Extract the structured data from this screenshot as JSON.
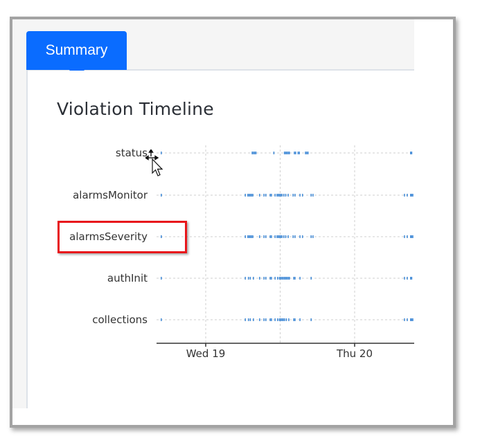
{
  "tabs": [
    {
      "label": "Summary",
      "active": true
    }
  ],
  "colors": {
    "tab_active": "#0a6cff",
    "event_mark": "#4a90d9",
    "highlight": "#e8161b",
    "gridline": "#cfcfcf"
  },
  "panel": {
    "title": "Violation Timeline"
  },
  "highlighted_row": "alarmsSeverity",
  "chart_data": {
    "type": "scatter",
    "title": "Violation Timeline",
    "xlabel": "",
    "ylabel": "",
    "x_unit": "hours since Wed 19 00:00",
    "xlim": [
      -8,
      17.3
    ],
    "x_ticks": [
      {
        "label": "Wed 19",
        "value": 0
      },
      {
        "label": "Thu 20",
        "value": 24
      }
    ],
    "x_gridlines": [
      0,
      12,
      24
    ],
    "categories": [
      "status",
      "alarmsMonitor",
      "alarmsSeverity",
      "authInit",
      "collections"
    ],
    "series": [
      {
        "name": "status",
        "events": [
          -8.2,
          7.4,
          7.6,
          7.8,
          8.0,
          10.9,
          12.6,
          12.8,
          13.0,
          13.2,
          13.4,
          14.2,
          14.4,
          14.8,
          15.0,
          16.0,
          16.2,
          16.4,
          33.0,
          33.2
        ]
      },
      {
        "name": "alarmsMonitor",
        "events": [
          -8.3,
          -8.2,
          6.3,
          6.7,
          6.9,
          7.1,
          7.3,
          7.5,
          8.6,
          9.3,
          9.6,
          10.3,
          10.5,
          11.1,
          11.4,
          11.6,
          11.8,
          12.0,
          12.2,
          12.5,
          12.8,
          13.2,
          14.0,
          14.3,
          15.1,
          15.5,
          16.9,
          17.2,
          31.9,
          32.4,
          33.0,
          33.2,
          33.4
        ]
      },
      {
        "name": "alarmsSeverity",
        "events": [
          -8.3,
          -8.2,
          6.3,
          6.7,
          6.9,
          7.1,
          7.3,
          7.5,
          8.6,
          9.3,
          9.6,
          10.3,
          10.5,
          11.1,
          11.4,
          11.6,
          11.8,
          12.0,
          12.2,
          12.5,
          12.8,
          13.2,
          14.0,
          14.3,
          15.1,
          15.5,
          16.9,
          17.2,
          31.9,
          32.4,
          33.0,
          33.2,
          33.4
        ]
      },
      {
        "name": "authInit",
        "events": [
          -8.2,
          6.3,
          6.8,
          7.1,
          7.6,
          8.6,
          9.3,
          9.6,
          10.3,
          10.5,
          11.1,
          11.5,
          11.8,
          12.0,
          12.2,
          12.4,
          12.6,
          12.8,
          13.0,
          13.2,
          13.4,
          14.1,
          14.3,
          15.1,
          16.9,
          31.9,
          32.4,
          33.0,
          33.2
        ]
      },
      {
        "name": "collections",
        "events": [
          -8.2,
          6.3,
          6.8,
          7.1,
          7.6,
          8.6,
          9.3,
          9.6,
          10.3,
          10.5,
          11.1,
          11.5,
          11.8,
          12.0,
          12.2,
          12.4,
          12.6,
          12.9,
          13.3,
          14.1,
          14.3,
          15.1,
          16.9,
          31.9,
          32.4,
          33.0,
          33.2,
          33.4
        ]
      }
    ],
    "grid": true,
    "legend": "none"
  }
}
